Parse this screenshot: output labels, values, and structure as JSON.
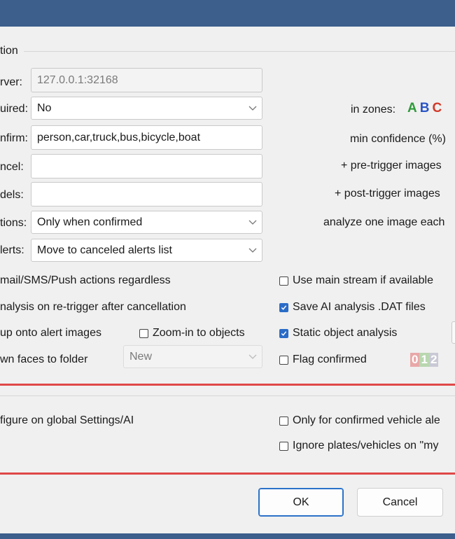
{
  "colors": {
    "titlebar": "#3c5f8c",
    "red_separator": "#e04848",
    "zone_a": "#2e9a3a",
    "zone_b": "#2b55c4",
    "zone_c": "#d23a2a"
  },
  "group": {
    "title": "tion"
  },
  "left_form": {
    "server": {
      "label": "rver:",
      "value": "127.0.0.1:32168"
    },
    "required": {
      "label": "uired:",
      "value": "No"
    },
    "confirm": {
      "label": "nfirm:",
      "value": "person,car,truck,bus,bicycle,boat"
    },
    "cancel": {
      "label": "ncel:",
      "value": ""
    },
    "models": {
      "label": "dels:",
      "value": ""
    },
    "actions": {
      "label": "tions:",
      "value": "Only when confirmed"
    },
    "alerts": {
      "label": "lerts:",
      "value": "Move to canceled alerts list"
    }
  },
  "right_form": {
    "in_zones_label": "in zones:",
    "zones": [
      "A",
      "B",
      "C"
    ],
    "min_confidence": "min confidence (%)",
    "pre_trigger": "+ pre-trigger images",
    "post_trigger": "+ post-trigger images",
    "analyze_each": "analyze one image each"
  },
  "options_left": {
    "actions_regardless": "mail/SMS/Push actions regardless",
    "retrigger": "nalysis on re-trigger after cancellation",
    "burn_label": "up onto alert images",
    "zoom_in": "Zoom-in to objects",
    "faces_label": "wn faces to folder",
    "faces_folder": "New"
  },
  "options_right": {
    "main_stream": "Use main stream if available",
    "save_dat": "Save AI analysis .DAT files",
    "static_analysis": "Static object analysis",
    "flag_confirmed": "Flag confirmed",
    "flag_digits": [
      "0",
      "1",
      "2"
    ]
  },
  "section2": {
    "configure_text": "figure on global Settings/AI",
    "only_confirmed": "Only for confirmed vehicle ale",
    "ignore_plates": "Ignore plates/vehicles on \"my"
  },
  "buttons": {
    "ok": "OK",
    "cancel": "Cancel"
  }
}
